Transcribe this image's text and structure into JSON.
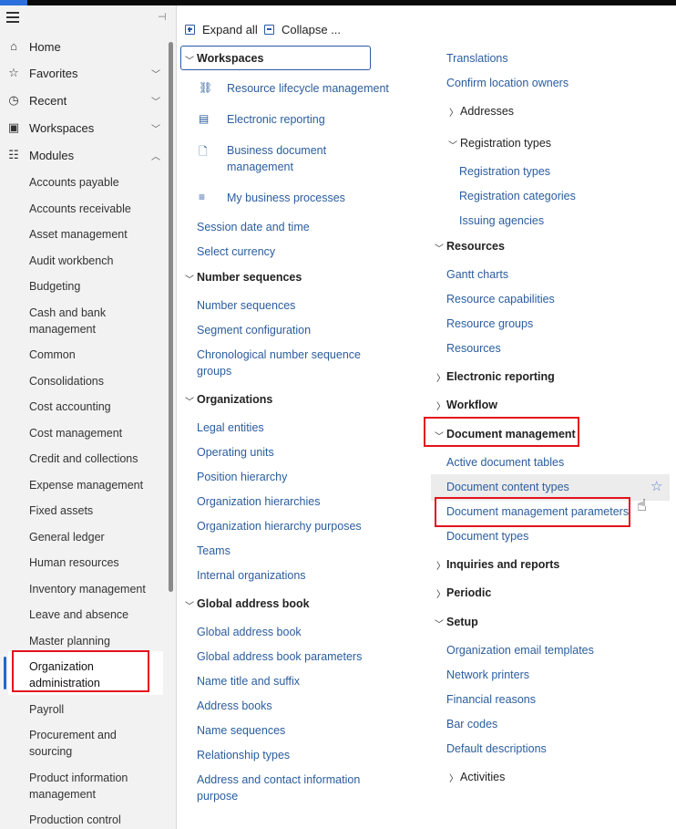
{
  "nav": {
    "main": [
      {
        "label": "Home",
        "icon": "home-icon",
        "glyph": "⌂",
        "chevron": ""
      },
      {
        "label": "Favorites",
        "icon": "star-icon",
        "glyph": "☆",
        "chevron": "﹀"
      },
      {
        "label": "Recent",
        "icon": "clock-icon",
        "glyph": "◷",
        "chevron": "﹀"
      },
      {
        "label": "Workspaces",
        "icon": "workspaces-icon",
        "glyph": "▣",
        "chevron": "﹀"
      },
      {
        "label": "Modules",
        "icon": "modules-icon",
        "glyph": "☷",
        "chevron": "︿"
      }
    ],
    "modules": [
      "Accounts payable",
      "Accounts receivable",
      "Asset management",
      "Audit workbench",
      "Budgeting",
      "Cash and bank management",
      "Common",
      "Consolidations",
      "Cost accounting",
      "Cost management",
      "Credit and collections",
      "Expense management",
      "Fixed assets",
      "General ledger",
      "Human resources",
      "Inventory management",
      "Leave and absence",
      "Master planning",
      "Organization administration",
      "Payroll",
      "Procurement and sourcing",
      "Product information management",
      "Production control"
    ],
    "active_module": "Organization administration"
  },
  "toolbar": {
    "expand_label": "Expand all",
    "collapse_label": "Collapse ..."
  },
  "col1": {
    "workspaces_header": "Workspaces",
    "workspaces": [
      {
        "label": "Resource lifecycle management",
        "icon": "lifecycle-icon",
        "glyph": "⛓"
      },
      {
        "label": "Electronic reporting",
        "icon": "report-icon",
        "glyph": "▤"
      },
      {
        "label": "Business document management",
        "icon": "document-icon",
        "glyph": "🗋"
      },
      {
        "label": "My business processes",
        "icon": "process-icon",
        "glyph": "≡"
      }
    ],
    "links_top": [
      "Session date and time",
      "Select currency"
    ],
    "number_sequences_header": "Number sequences",
    "number_sequences": [
      "Number sequences",
      "Segment configuration",
      "Chronological number sequence groups"
    ],
    "organizations_header": "Organizations",
    "organizations": [
      "Legal entities",
      "Operating units",
      "Position hierarchy",
      "Organization hierarchies",
      "Organization hierarchy purposes",
      "Teams",
      "Internal organizations"
    ],
    "gab_header": "Global address book",
    "gab": [
      "Global address book",
      "Global address book parameters",
      "Name title and suffix",
      "Address books",
      "Name sequences",
      "Relationship types",
      "Address and contact information purpose"
    ]
  },
  "col2": {
    "links_top": [
      "Translations",
      "Confirm location owners"
    ],
    "addresses_label": "Addresses",
    "registration_types_label": "Registration types",
    "registration": [
      "Registration types",
      "Registration categories",
      "Issuing agencies"
    ],
    "resources_header": "Resources",
    "resources": [
      "Gantt charts",
      "Resource capabilities",
      "Resource groups",
      "Resources"
    ],
    "electronic_reporting_header": "Electronic reporting",
    "workflow_header": "Workflow",
    "document_management_header": "Document management",
    "document_management": [
      "Active document tables",
      "Document content types",
      "Document management parameters",
      "Document types"
    ],
    "inquiries_header": "Inquiries and reports",
    "periodic_header": "Periodic",
    "setup_header": "Setup",
    "setup": [
      "Organization email templates",
      "Network printers",
      "Financial reasons",
      "Bar codes",
      "Default descriptions"
    ],
    "activities_label": "Activities"
  },
  "colors": {
    "link": "#2b5d9e",
    "highlight_red": "#e3121b",
    "nav_bg": "#f2f2f2",
    "active_bar": "#2266cc"
  }
}
